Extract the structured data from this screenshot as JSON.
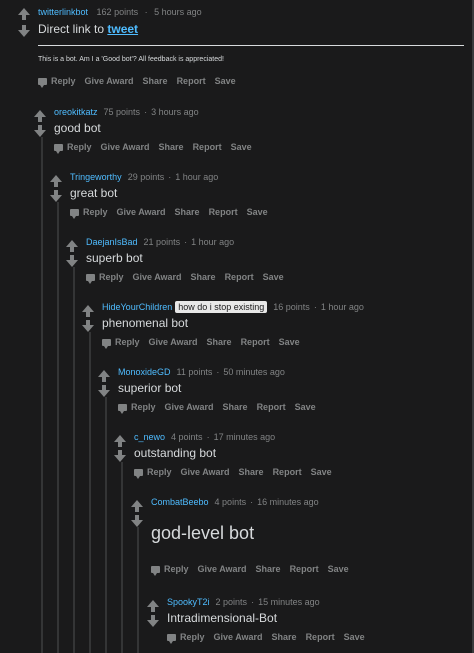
{
  "comments": [
    {
      "user": "twitterlinkbot",
      "points": "162 points",
      "time": "5 hours ago",
      "body": "Direct link to ",
      "link": "tweet",
      "note": "This is a bot. Am I a 'Good bot'? All feedback is appreciated!"
    },
    {
      "user": "oreokitkatz",
      "points": "75 points",
      "time": "3 hours ago",
      "body": "good bot"
    },
    {
      "user": "Tringeworthy",
      "points": "29 points",
      "time": "1 hour ago",
      "body": "great bot"
    },
    {
      "user": "DaejanIsBad",
      "points": "21 points",
      "time": "1 hour ago",
      "body": "superb bot"
    },
    {
      "user": "HideYourChildren",
      "flair": "how do i stop existing",
      "points": "16 points",
      "time": "1 hour ago",
      "body": "phenomenal bot"
    },
    {
      "user": "MonoxideGD",
      "points": "11 points",
      "time": "50 minutes ago",
      "body": "superior bot"
    },
    {
      "user": "c_newo",
      "points": "4 points",
      "time": "17 minutes ago",
      "body": "outstanding bot"
    },
    {
      "user": "CombatBeebo",
      "points": "4 points",
      "time": "16 minutes ago",
      "body": "god-level bot"
    },
    {
      "user": "SpookyT2i",
      "points": "15 minutes ago",
      "points_label": "2 points",
      "time": "15 minutes ago",
      "body": "Intradimensional-Bot"
    }
  ],
  "actions": {
    "reply": "Reply",
    "award": "Give Award",
    "share": "Share",
    "report": "Report",
    "save": "Save"
  },
  "dot": "·"
}
